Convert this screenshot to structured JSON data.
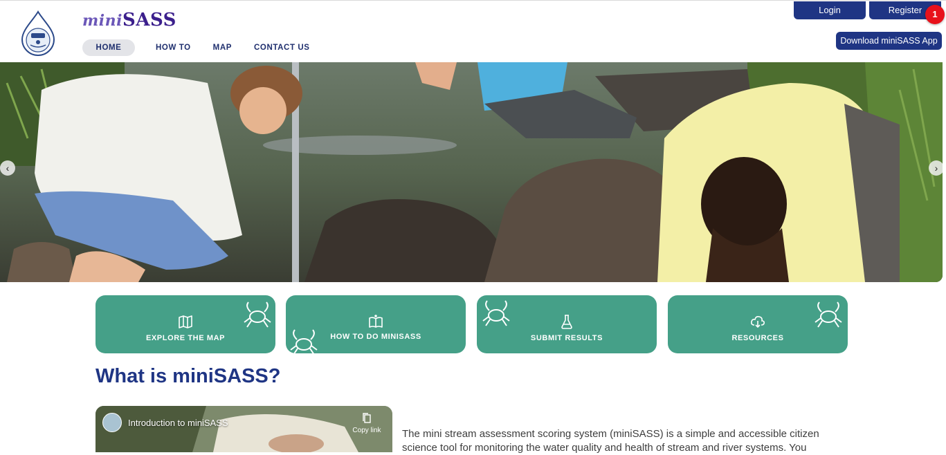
{
  "header": {
    "brand_mini": "mini",
    "brand_sass": "SASS",
    "nav": [
      "HOME",
      "HOW TO",
      "MAP",
      "CONTACT US"
    ],
    "login": "Login",
    "register": "Register",
    "notification_count": "1",
    "download_app": "Download miniSASS App"
  },
  "carousel": {
    "prev": "‹",
    "next": "›"
  },
  "cards": [
    {
      "label": "EXPLORE THE MAP",
      "icon": "map-icon"
    },
    {
      "label": "HOW TO DO MINISASS",
      "icon": "book-icon"
    },
    {
      "label": "SUBMIT RESULTS",
      "icon": "flask-icon"
    },
    {
      "label": "RESOURCES",
      "icon": "cloud-download-icon"
    }
  ],
  "main": {
    "heading": "What is miniSASS?",
    "video_title": "Introduction to miniSASS",
    "copy_link": "Copy link",
    "intro": "The mini stream assessment scoring system (miniSASS) is a simple and accessible citizen science tool for monitoring the water quality and health of stream and river systems. You"
  },
  "colors": {
    "navy": "#1f3584",
    "teal": "#45a088",
    "badge_red": "#e8111b"
  }
}
